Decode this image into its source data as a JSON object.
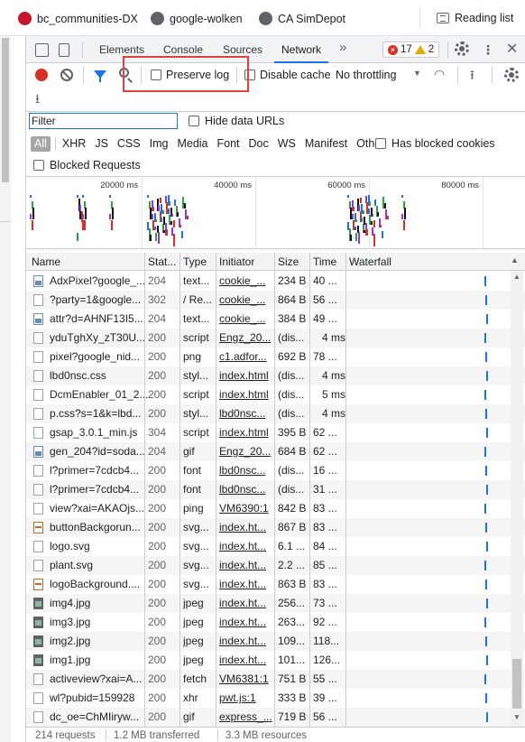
{
  "bookmarks": [
    {
      "label": "bc_communities-DX",
      "icon": "brand-logo-icon"
    },
    {
      "label": "google-wolken",
      "icon": "globe-icon"
    },
    {
      "label": "CA SimDepot",
      "icon": "globe-icon"
    },
    {
      "label": "Reading list",
      "icon": "reading-list-icon"
    }
  ],
  "devtools": {
    "tabs": [
      "Elements",
      "Console",
      "Sources",
      "Network"
    ],
    "active_tab": "Network",
    "more_tabs": "»",
    "error_count": "17",
    "warning_count": "2",
    "kebab": "⋮",
    "close": "✕"
  },
  "toolbar": {
    "preserve_log": "Preserve log",
    "disable_cache": "Disable cache",
    "throttling": "No throttling",
    "throttling_arrow": "▼"
  },
  "filter": {
    "placeholder": "Filter",
    "hide_data_urls": "Hide data URLs",
    "types": [
      "All",
      "XHR",
      "JS",
      "CSS",
      "Img",
      "Media",
      "Font",
      "Doc",
      "WS",
      "Manifest",
      "Other"
    ],
    "active_type": "All",
    "has_blocked_cookies": "Has blocked cookies",
    "blocked_requests": "Blocked Requests"
  },
  "overview": {
    "ticks": [
      "20000 ms",
      "40000 ms",
      "60000 ms",
      "80000 ms"
    ]
  },
  "columns": [
    "Name",
    "Stat...",
    "Type",
    "Initiator",
    "Size",
    "Time",
    "Waterfall"
  ],
  "sort_arrow": "▲",
  "rows": [
    {
      "name": "AdxPixel?google_...",
      "status": "204",
      "type": "text...",
      "initiator": "cookie_...",
      "size": "234 B",
      "time": "40 ...",
      "icon": "pic"
    },
    {
      "name": "?party=1&google...",
      "status": "302",
      "type": "/ Re...",
      "initiator": "cookie_...",
      "size": "864 B",
      "time": "56 ...",
      "icon": "doc"
    },
    {
      "name": "attr?d=AHNF13I5...",
      "status": "204",
      "type": "text...",
      "initiator": "cookie_...",
      "size": "384 B",
      "time": "49 ...",
      "icon": "pic"
    },
    {
      "name": "yduTghXy_zT30U...",
      "status": "200",
      "type": "script",
      "initiator": "Engz_20...",
      "size": "(dis...",
      "time": "4 ms",
      "icon": "doc"
    },
    {
      "name": "pixel?google_nid...",
      "status": "200",
      "type": "png",
      "initiator": "c1.adfor...",
      "size": "692 B",
      "time": "78 ...",
      "icon": "doc"
    },
    {
      "name": "lbd0nsc.css",
      "status": "200",
      "type": "styl...",
      "initiator": "index.html",
      "size": "(dis...",
      "time": "4 ms",
      "icon": "doc"
    },
    {
      "name": "DcmEnabler_01_2...",
      "status": "200",
      "type": "script",
      "initiator": "index.html",
      "size": "(dis...",
      "time": "5 ms",
      "icon": "doc"
    },
    {
      "name": "p.css?s=1&k=lbd...",
      "status": "200",
      "type": "styl...",
      "initiator": "lbd0nsc...",
      "size": "(dis...",
      "time": "4 ms",
      "icon": "doc"
    },
    {
      "name": "gsap_3.0.1_min.js",
      "status": "304",
      "type": "script",
      "initiator": "index.html",
      "size": "395 B",
      "time": "62 ...",
      "icon": "doc"
    },
    {
      "name": "gen_204?id=soda...",
      "status": "204",
      "type": "gif",
      "initiator": "Engz_20...",
      "size": "684 B",
      "time": "62 ...",
      "icon": "pic"
    },
    {
      "name": "l?primer=7cdcb4...",
      "status": "200",
      "type": "font",
      "initiator": "lbd0nsc...",
      "size": "(dis...",
      "time": "16 ...",
      "icon": "doc"
    },
    {
      "name": "l?primer=7cdcb4...",
      "status": "200",
      "type": "font",
      "initiator": "lbd0nsc...",
      "size": "(dis...",
      "time": "31 ...",
      "icon": "doc"
    },
    {
      "name": "view?xai=AKAOjs...",
      "status": "200",
      "type": "ping",
      "initiator": "VM6390:1",
      "size": "842 B",
      "time": "83 ...",
      "icon": "doc"
    },
    {
      "name": "buttonBackgorun...",
      "status": "200",
      "type": "svg...",
      "initiator": "index.ht...",
      "size": "867 B",
      "time": "83 ...",
      "icon": "svg"
    },
    {
      "name": "logo.svg",
      "status": "200",
      "type": "svg...",
      "initiator": "index.ht...",
      "size": "6.1 ...",
      "time": "84 ...",
      "icon": "doc"
    },
    {
      "name": "plant.svg",
      "status": "200",
      "type": "svg...",
      "initiator": "index.ht...",
      "size": "2.2 ...",
      "time": "85 ...",
      "icon": "doc"
    },
    {
      "name": "logoBackground....",
      "status": "200",
      "type": "svg...",
      "initiator": "index.ht...",
      "size": "863 B",
      "time": "83 ...",
      "icon": "svg"
    },
    {
      "name": "img4.jpg",
      "status": "200",
      "type": "jpeg",
      "initiator": "index.ht...",
      "size": "256...",
      "time": "73 ...",
      "icon": "img"
    },
    {
      "name": "img3.jpg",
      "status": "200",
      "type": "jpeg",
      "initiator": "index.ht...",
      "size": "263...",
      "time": "92 ...",
      "icon": "img"
    },
    {
      "name": "img2.jpg",
      "status": "200",
      "type": "jpeg",
      "initiator": "index.ht...",
      "size": "109...",
      "time": "118...",
      "icon": "img"
    },
    {
      "name": "img1.jpg",
      "status": "200",
      "type": "jpeg",
      "initiator": "index.ht...",
      "size": "101...",
      "time": "126...",
      "icon": "img"
    },
    {
      "name": "activeview?xai=A...",
      "status": "200",
      "type": "fetch",
      "initiator": "VM6381:1",
      "size": "751 B",
      "time": "55 ...",
      "icon": "doc"
    },
    {
      "name": "wl?pubid=159928",
      "status": "200",
      "type": "xhr",
      "initiator": "pwt.js:1",
      "size": "333 B",
      "time": "39 ...",
      "icon": "doc"
    },
    {
      "name": "dc_oe=ChMIiryw...",
      "status": "200",
      "type": "gif",
      "initiator": "express_...",
      "size": "719 B",
      "time": "56 ...",
      "icon": "doc"
    }
  ],
  "status_bar": {
    "requests": "214 requests",
    "transferred": "1.2 MB transferred",
    "resources": "3.3 MB resources"
  }
}
